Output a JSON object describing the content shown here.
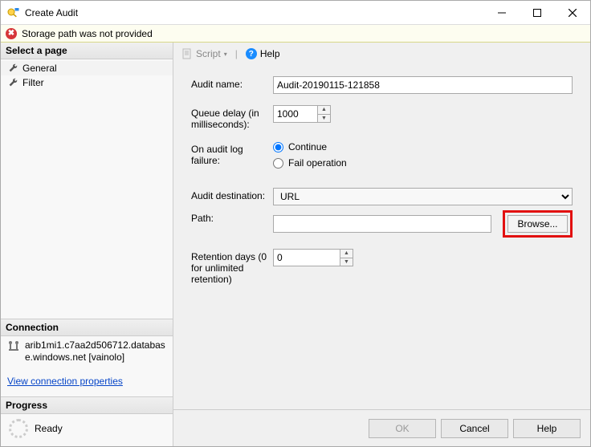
{
  "window": {
    "title": "Create Audit"
  },
  "alert": {
    "message": "Storage path was not provided"
  },
  "sidebar": {
    "selectHeader": "Select a page",
    "items": [
      {
        "label": "General"
      },
      {
        "label": "Filter"
      }
    ],
    "connectionHeader": "Connection",
    "connectionText": "arib1mi1.c7aa2d506712.database.windows.net [vainolo]",
    "viewLink": "View connection properties",
    "progressHeader": "Progress",
    "progressText": "Ready"
  },
  "toolbar": {
    "script": "Script",
    "help": "Help"
  },
  "form": {
    "auditNameLabel": "Audit name:",
    "auditNameValue": "Audit-20190115-121858",
    "queueDelayLabel": "Queue delay (in milliseconds):",
    "queueDelayValue": "1000",
    "failureLabel": "On audit log failure:",
    "failureOptions": {
      "continue": "Continue",
      "fail": "Fail operation"
    },
    "failureSelected": "continue",
    "destinationLabel": "Audit destination:",
    "destinationValue": "URL",
    "pathLabel": "Path:",
    "pathValue": "",
    "browse": "Browse...",
    "retentionLabel": "Retention days (0 for unlimited retention)",
    "retentionValue": "0"
  },
  "footer": {
    "ok": "OK",
    "cancel": "Cancel",
    "help": "Help"
  }
}
